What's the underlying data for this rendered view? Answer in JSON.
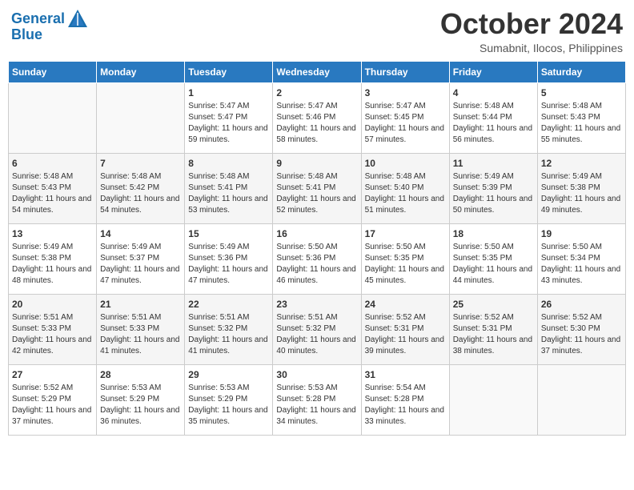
{
  "header": {
    "logo_line1": "General",
    "logo_line2": "Blue",
    "month": "October 2024",
    "location": "Sumabnit, Ilocos, Philippines"
  },
  "days_of_week": [
    "Sunday",
    "Monday",
    "Tuesday",
    "Wednesday",
    "Thursday",
    "Friday",
    "Saturday"
  ],
  "weeks": [
    [
      {
        "day": "",
        "sunrise": "",
        "sunset": "",
        "daylight": ""
      },
      {
        "day": "",
        "sunrise": "",
        "sunset": "",
        "daylight": ""
      },
      {
        "day": "1",
        "sunrise": "Sunrise: 5:47 AM",
        "sunset": "Sunset: 5:47 PM",
        "daylight": "Daylight: 11 hours and 59 minutes."
      },
      {
        "day": "2",
        "sunrise": "Sunrise: 5:47 AM",
        "sunset": "Sunset: 5:46 PM",
        "daylight": "Daylight: 11 hours and 58 minutes."
      },
      {
        "day": "3",
        "sunrise": "Sunrise: 5:47 AM",
        "sunset": "Sunset: 5:45 PM",
        "daylight": "Daylight: 11 hours and 57 minutes."
      },
      {
        "day": "4",
        "sunrise": "Sunrise: 5:48 AM",
        "sunset": "Sunset: 5:44 PM",
        "daylight": "Daylight: 11 hours and 56 minutes."
      },
      {
        "day": "5",
        "sunrise": "Sunrise: 5:48 AM",
        "sunset": "Sunset: 5:43 PM",
        "daylight": "Daylight: 11 hours and 55 minutes."
      }
    ],
    [
      {
        "day": "6",
        "sunrise": "Sunrise: 5:48 AM",
        "sunset": "Sunset: 5:43 PM",
        "daylight": "Daylight: 11 hours and 54 minutes."
      },
      {
        "day": "7",
        "sunrise": "Sunrise: 5:48 AM",
        "sunset": "Sunset: 5:42 PM",
        "daylight": "Daylight: 11 hours and 54 minutes."
      },
      {
        "day": "8",
        "sunrise": "Sunrise: 5:48 AM",
        "sunset": "Sunset: 5:41 PM",
        "daylight": "Daylight: 11 hours and 53 minutes."
      },
      {
        "day": "9",
        "sunrise": "Sunrise: 5:48 AM",
        "sunset": "Sunset: 5:41 PM",
        "daylight": "Daylight: 11 hours and 52 minutes."
      },
      {
        "day": "10",
        "sunrise": "Sunrise: 5:48 AM",
        "sunset": "Sunset: 5:40 PM",
        "daylight": "Daylight: 11 hours and 51 minutes."
      },
      {
        "day": "11",
        "sunrise": "Sunrise: 5:49 AM",
        "sunset": "Sunset: 5:39 PM",
        "daylight": "Daylight: 11 hours and 50 minutes."
      },
      {
        "day": "12",
        "sunrise": "Sunrise: 5:49 AM",
        "sunset": "Sunset: 5:38 PM",
        "daylight": "Daylight: 11 hours and 49 minutes."
      }
    ],
    [
      {
        "day": "13",
        "sunrise": "Sunrise: 5:49 AM",
        "sunset": "Sunset: 5:38 PM",
        "daylight": "Daylight: 11 hours and 48 minutes."
      },
      {
        "day": "14",
        "sunrise": "Sunrise: 5:49 AM",
        "sunset": "Sunset: 5:37 PM",
        "daylight": "Daylight: 11 hours and 47 minutes."
      },
      {
        "day": "15",
        "sunrise": "Sunrise: 5:49 AM",
        "sunset": "Sunset: 5:36 PM",
        "daylight": "Daylight: 11 hours and 47 minutes."
      },
      {
        "day": "16",
        "sunrise": "Sunrise: 5:50 AM",
        "sunset": "Sunset: 5:36 PM",
        "daylight": "Daylight: 11 hours and 46 minutes."
      },
      {
        "day": "17",
        "sunrise": "Sunrise: 5:50 AM",
        "sunset": "Sunset: 5:35 PM",
        "daylight": "Daylight: 11 hours and 45 minutes."
      },
      {
        "day": "18",
        "sunrise": "Sunrise: 5:50 AM",
        "sunset": "Sunset: 5:35 PM",
        "daylight": "Daylight: 11 hours and 44 minutes."
      },
      {
        "day": "19",
        "sunrise": "Sunrise: 5:50 AM",
        "sunset": "Sunset: 5:34 PM",
        "daylight": "Daylight: 11 hours and 43 minutes."
      }
    ],
    [
      {
        "day": "20",
        "sunrise": "Sunrise: 5:51 AM",
        "sunset": "Sunset: 5:33 PM",
        "daylight": "Daylight: 11 hours and 42 minutes."
      },
      {
        "day": "21",
        "sunrise": "Sunrise: 5:51 AM",
        "sunset": "Sunset: 5:33 PM",
        "daylight": "Daylight: 11 hours and 41 minutes."
      },
      {
        "day": "22",
        "sunrise": "Sunrise: 5:51 AM",
        "sunset": "Sunset: 5:32 PM",
        "daylight": "Daylight: 11 hours and 41 minutes."
      },
      {
        "day": "23",
        "sunrise": "Sunrise: 5:51 AM",
        "sunset": "Sunset: 5:32 PM",
        "daylight": "Daylight: 11 hours and 40 minutes."
      },
      {
        "day": "24",
        "sunrise": "Sunrise: 5:52 AM",
        "sunset": "Sunset: 5:31 PM",
        "daylight": "Daylight: 11 hours and 39 minutes."
      },
      {
        "day": "25",
        "sunrise": "Sunrise: 5:52 AM",
        "sunset": "Sunset: 5:31 PM",
        "daylight": "Daylight: 11 hours and 38 minutes."
      },
      {
        "day": "26",
        "sunrise": "Sunrise: 5:52 AM",
        "sunset": "Sunset: 5:30 PM",
        "daylight": "Daylight: 11 hours and 37 minutes."
      }
    ],
    [
      {
        "day": "27",
        "sunrise": "Sunrise: 5:52 AM",
        "sunset": "Sunset: 5:29 PM",
        "daylight": "Daylight: 11 hours and 37 minutes."
      },
      {
        "day": "28",
        "sunrise": "Sunrise: 5:53 AM",
        "sunset": "Sunset: 5:29 PM",
        "daylight": "Daylight: 11 hours and 36 minutes."
      },
      {
        "day": "29",
        "sunrise": "Sunrise: 5:53 AM",
        "sunset": "Sunset: 5:29 PM",
        "daylight": "Daylight: 11 hours and 35 minutes."
      },
      {
        "day": "30",
        "sunrise": "Sunrise: 5:53 AM",
        "sunset": "Sunset: 5:28 PM",
        "daylight": "Daylight: 11 hours and 34 minutes."
      },
      {
        "day": "31",
        "sunrise": "Sunrise: 5:54 AM",
        "sunset": "Sunset: 5:28 PM",
        "daylight": "Daylight: 11 hours and 33 minutes."
      },
      {
        "day": "",
        "sunrise": "",
        "sunset": "",
        "daylight": ""
      },
      {
        "day": "",
        "sunrise": "",
        "sunset": "",
        "daylight": ""
      }
    ]
  ]
}
